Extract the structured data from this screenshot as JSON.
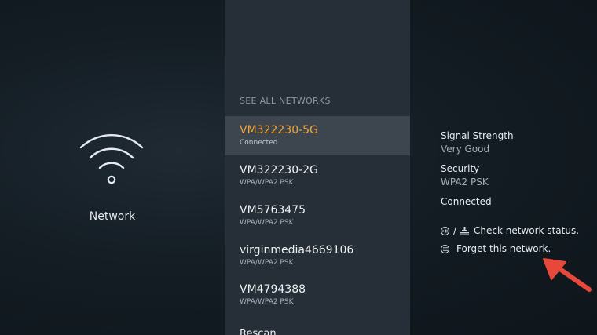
{
  "left_panel": {
    "icon": "wifi-icon",
    "label": "Network"
  },
  "network_list": {
    "section_title": "SEE ALL NETWORKS",
    "items": [
      {
        "name": "VM322230-5G",
        "status": "Connected",
        "selected": true
      },
      {
        "name": "VM322230-2G",
        "status": "WPA/WPA2 PSK",
        "selected": false
      },
      {
        "name": "VM5763475",
        "status": "WPA/WPA2 PSK",
        "selected": false
      },
      {
        "name": "virginmedia4669106",
        "status": "WPA/WPA2 PSK",
        "selected": false
      },
      {
        "name": "VM4794388",
        "status": "WPA/WPA2 PSK",
        "selected": false
      }
    ],
    "rescan_label": "Rescan"
  },
  "details": {
    "signal_label": "Signal Strength",
    "signal_value": "Very Good",
    "security_label": "Security",
    "security_value": "WPA2 PSK",
    "connection_state": "Connected",
    "check_status": {
      "icons": [
        "play-pause-button-icon",
        "ethernet-icon"
      ],
      "separator": "/",
      "text": "Check network status."
    },
    "forget": {
      "icon": "menu-button-icon",
      "text": "Forget this network."
    }
  },
  "annotation": {
    "icon": "red-arrow-icon",
    "color": "#e8483a"
  },
  "colors": {
    "selected_text": "#f0a43a",
    "list_background": "#262f37",
    "selected_background": "#3d464e"
  }
}
